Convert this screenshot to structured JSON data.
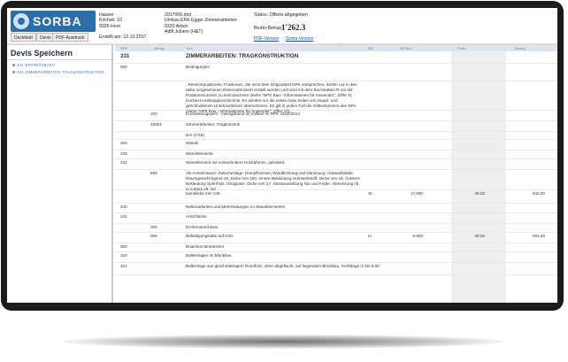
{
  "brand": {
    "name": "SORBA",
    "accent": "#2e6ea8"
  },
  "header": {
    "address_left": [
      "Hauser",
      "Kirchstr. 10",
      "9326 Horn"
    ],
    "address_right": [
      "2017006.dxd",
      "Umbau EFH Egger Zimmerarbeiten",
      "9320 Arbon",
      "Adlfi Juliano (H&T)"
    ],
    "status": "Status: Offerte abgegeben",
    "total_label": "Brutto-Betrag",
    "total_value": "1'262.3",
    "pdf_version": "PDF-Version",
    "sorba_version": "Sorba-Version",
    "created": "Erstellt am: 12.10.2017"
  },
  "toolbar": {
    "deckblatt": "Deckblatt",
    "devis": "Devis",
    "pdf_ausdruck": "PDF-Ausdruck"
  },
  "sidebar": {
    "title": "Devis Speichern",
    "items": [
      {
        "label": "331: ERTRETOBARU"
      },
      {
        "label": "331: ZIMMERARBEITEN: TRAGKONSTRUKTION"
      }
    ]
  },
  "table": {
    "columns": [
      "NPK",
      "Menge",
      "Text",
      "ME",
      "MF/MLF",
      "Preis",
      "Betrag"
    ],
    "rows": [
      {
        "npk": "331",
        "sub": "",
        "text": "ZIMMERARBEITEN: TRAGKONSTRUKTION",
        "me": "",
        "qty": "",
        "price": "",
        "amount": "",
        "heading": true
      },
      {
        "npk": "000",
        "sub": "",
        "text": "Bedingungen",
        "me": "",
        "qty": "",
        "price": "",
        "amount": ""
      },
      {
        "npk": "",
        "sub": "",
        "text": ". Reservepositionen: Positionen, die nicht dem Originaltext NPK entsprechen, dürfen nur in den dafür vorgesehenen Reservefenstern erstellt werden und sind mit dem Buchstaben R vor der Positionsnummer zu kennzeichnen (siehe \"NPK Bau - Informationen für Anwender\", Ziffer 6). . Kurztext-Leistungsverzeichnis: Es werden nur die ersten zwei Zeilen von Haupt- und geschlossenen Unterpositionen übernommen. Es gilt in jedem Fall die Volltextversion des NPK (siehe \"NPK Bau - Informationen für Anwender\", Ziffer 10).",
        "me": "",
        "qty": "",
        "price": "",
        "amount": ""
      },
      {
        "npk": "",
        "sub": "100",
        "text": "Kurzleistungsverz.: massgebend ist Volltext im NPK 331D/2014.",
        "me": "",
        "qty": "",
        "price": "",
        "amount": ""
      },
      {
        "npk": "",
        "sub": "10001",
        "text": "Zimmerarbeiten: Tragkonstruk",
        "me": "",
        "qty": "",
        "price": "",
        "amount": ""
      },
      {
        "npk": "",
        "sub": "",
        "text": "tion (V'15)",
        "me": "",
        "qty": "",
        "price": "",
        "amount": ""
      },
      {
        "npk": "200",
        "sub": "",
        "text": "Wände",
        "me": "",
        "qty": "",
        "price": "",
        "amount": ""
      },
      {
        "npk": "230",
        "sub": "",
        "text": "Wandelemente",
        "me": "",
        "qty": "",
        "price": "",
        "amount": ""
      },
      {
        "npk": "231",
        "sub": "",
        "text": "Wandelement mit umlaufendem Holzrahmen, gehobelt.",
        "me": "",
        "qty": "",
        "price": "",
        "amount": ""
      },
      {
        "npk": "",
        "sub": "889",
        "text": "Als Aussenwand. Zwischenlage: Dampfbremse, Winddichtung und Dämmung. Glaswollplatte, Raumgewicht kg/m3 40, Dicke mm 100. Innere Bekleidung Holzwerkstoff, Dicke mm 18. Äussere Bekleidung Sperrholz, Douglasie, Dicke mm 17. Stossausbildung Nut und Feder. Abmessung l/b m 2.50x1.25. Ge",
        "me": "",
        "qty": "",
        "price": "",
        "amount": ""
      },
      {
        "npk": "",
        "sub": "",
        "text": "samtdicke mm 135.",
        "me": "St",
        "qty": "17.000",
        "price": "26.00",
        "amount": "442.00"
      },
      {
        "npk": "240",
        "sub": "",
        "text": "Nebenarbeiten und Mehrleistungen zu Wandelementen",
        "me": "",
        "qty": "",
        "price": "",
        "amount": ""
      },
      {
        "npk": "241",
        "sub": "",
        "text": "Anschlüsse.",
        "me": "",
        "qty": "",
        "price": "",
        "amount": ""
      },
      {
        "npk": "",
        "sub": "300",
        "text": "Deckenanschluss.",
        "me": "",
        "qty": "",
        "price": "",
        "amount": ""
      },
      {
        "npk": "",
        "sub": "309",
        "text": "Befestigungslatte auf Holz.",
        "me": "m",
        "qty": "9.600",
        "price": "29.00",
        "amount": "261.00"
      },
      {
        "npk": "300",
        "sub": "",
        "text": "Bodenkonstruktionen",
        "me": "",
        "qty": "",
        "price": "",
        "amount": ""
      },
      {
        "npk": "320",
        "sub": "",
        "text": "Balkenlagen im Blockbau",
        "me": "",
        "qty": "",
        "price": "",
        "amount": ""
      },
      {
        "npk": "321",
        "sub": "",
        "text": "Balkenlage aus gleichmässigem Rundholz, oben abgeflacht, auf liegendem Blockbau. Holzlänge m bis 6.00.",
        "me": "",
        "qty": "",
        "price": "",
        "amount": ""
      }
    ]
  }
}
